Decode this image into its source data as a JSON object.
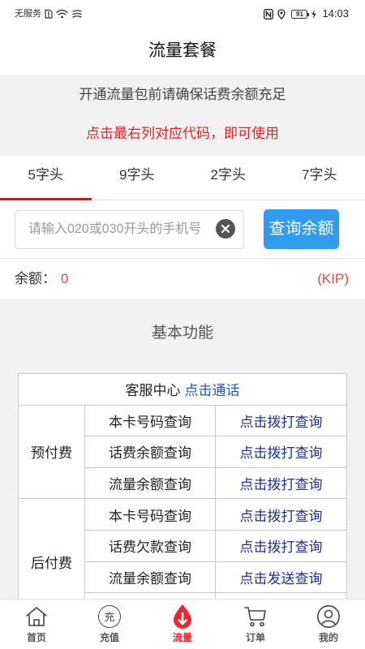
{
  "status_bar": {
    "carrier": "无服务",
    "battery_level": "91",
    "time": "14:03",
    "icons": [
      "sim-alert-icon",
      "wifi-icon",
      "network-signal-icon",
      "nfc-icon",
      "location-icon",
      "battery-icon",
      "charging-icon"
    ]
  },
  "header": {
    "title": "流量套餐"
  },
  "notice": {
    "line1": "开通流量包前请确保话费余额充足",
    "line2": "点击最右列对应代码，即可使用"
  },
  "tabs": [
    {
      "label": "5字头",
      "active": true
    },
    {
      "label": "9字头",
      "active": false
    },
    {
      "label": "2字头",
      "active": false
    },
    {
      "label": "7字头",
      "active": false
    }
  ],
  "search": {
    "value": "",
    "placeholder": "请输入020或030开头的手机号",
    "clear_icon": "clear-icon",
    "button_label": "查询余额"
  },
  "balance": {
    "label": "余额：",
    "value": "0",
    "unit": "(KIP)"
  },
  "section_title": "基本功能",
  "service_table": {
    "header_label": "客服中心",
    "header_link": "点击通话",
    "groups": [
      {
        "name": "预付费",
        "rows": [
          {
            "item": "本卡号码查询",
            "action": "点击拨打查询"
          },
          {
            "item": "话费余额查询",
            "action": "点击拨打查询"
          },
          {
            "item": "流量余额查询",
            "action": "点击拨打查询"
          }
        ]
      },
      {
        "name": "后付费",
        "rows": [
          {
            "item": "本卡号码查询",
            "action": "点击拨打查询"
          },
          {
            "item": "话费欠款查询",
            "action": "点击拨打查询"
          },
          {
            "item": "流量余额查询",
            "action": "点击发送查询"
          }
        ]
      }
    ]
  },
  "bottom_nav": [
    {
      "label": "首页",
      "icon": "home-icon",
      "active": false
    },
    {
      "label": "充值",
      "icon": "recharge-icon",
      "icon_text": "充",
      "active": false
    },
    {
      "label": "流量",
      "icon": "data-drop-icon",
      "active": true
    },
    {
      "label": "订单",
      "icon": "cart-icon",
      "active": false
    },
    {
      "label": "我的",
      "icon": "profile-icon",
      "active": false
    }
  ],
  "colors": {
    "notice_red": "#e8201f",
    "tab_indicator": "#a6262c",
    "query_button": "#2f9cf0",
    "link_blue": "#1f2f9d",
    "call_link_blue": "#2456c8",
    "balance_red": "#e04848",
    "page_gray": "#f2f2f2",
    "active_nav": "#e8282b"
  }
}
